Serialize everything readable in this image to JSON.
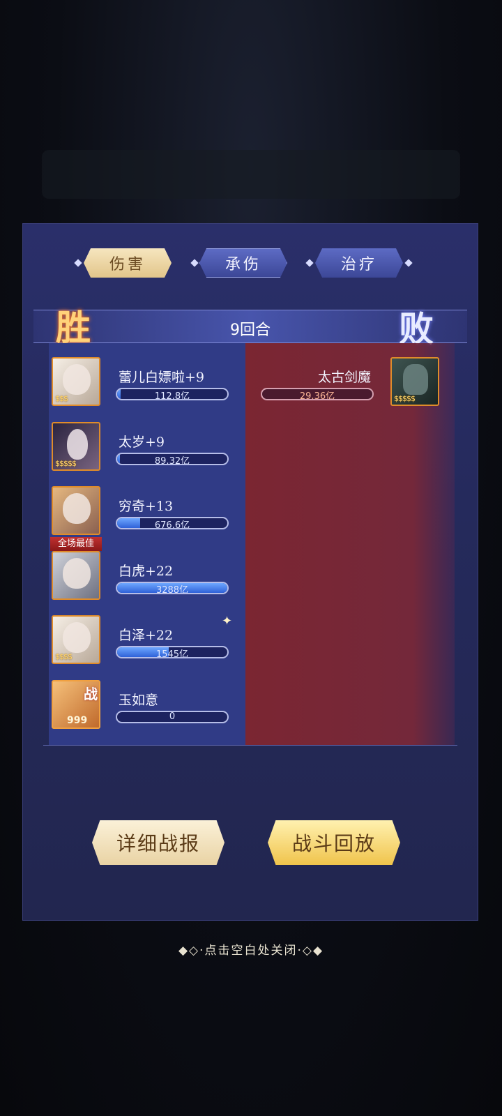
{
  "tabs": [
    {
      "label": "伤害",
      "active": true
    },
    {
      "label": "承伤",
      "active": false
    },
    {
      "label": "治疗",
      "active": false
    }
  ],
  "round": "9回合",
  "result": {
    "win": "胜",
    "lose": "败"
  },
  "left_team": [
    {
      "name": "蕾儿白嫖啦+9",
      "value": "112.8亿",
      "stars": "$$$",
      "fill": 0.03
    },
    {
      "name": "太岁+9",
      "value": "89.32亿",
      "stars": "$$$$$",
      "fill": 0.027
    },
    {
      "name": "穷奇+13",
      "value": "676.6亿",
      "stars": "",
      "fill": 0.21
    },
    {
      "name": "白虎+22",
      "value": "3288亿",
      "stars": "",
      "best": "全场最佳",
      "fill": 1.0
    },
    {
      "name": "白泽+22",
      "value": "1545亿",
      "stars": "$$$$",
      "fill": 0.47
    },
    {
      "name": "玉如意",
      "value": "0",
      "badge": "战",
      "level": "999",
      "fill": 0
    }
  ],
  "right_team": [
    {
      "name": "太古剑魔",
      "value": "29.36亿",
      "stars": "$$$$$",
      "fill": 0.0
    }
  ],
  "buttons": {
    "detail": "详细战报",
    "replay": "战斗回放"
  },
  "close_hint": "◆◇·点击空白处关闭·◇◆",
  "colors": {
    "accent_gold": "#e2c58a",
    "win_side": "#303b86",
    "lose_side": "#7b2632",
    "bar_fill": "#2f62d8"
  }
}
